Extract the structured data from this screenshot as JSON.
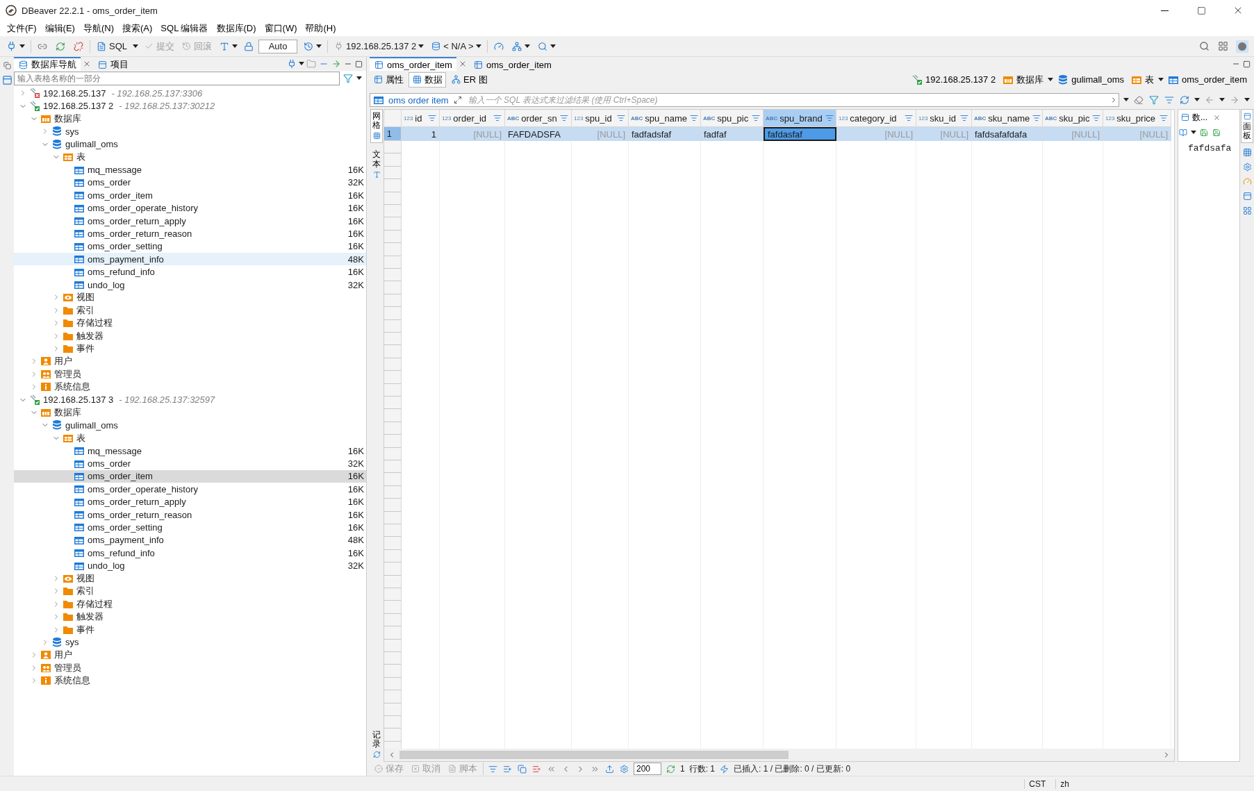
{
  "window": {
    "title": "DBeaver 22.2.1 - oms_order_item"
  },
  "menu": [
    "文件(F)",
    "编辑(E)",
    "导航(N)",
    "搜索(A)",
    "SQL 编辑器",
    "数据库(D)",
    "窗口(W)",
    "帮助(H)"
  ],
  "toolbar": {
    "sql": "SQL",
    "commit": {
      "label": "提交",
      "disabled": true
    },
    "rollback": {
      "label": "回滚",
      "disabled": true
    },
    "mode": "Auto",
    "connection": "192.168.25.137 2",
    "schema": "< N/A >"
  },
  "navigator": {
    "tabs": [
      {
        "label": "数据库导航",
        "selected": true,
        "closable": true
      },
      {
        "label": "项目",
        "selected": false,
        "closable": false
      }
    ],
    "filter": {
      "placeholder": "输入表格名称的一部分"
    },
    "tree": [
      {
        "kind": "connection",
        "label": "192.168.25.137",
        "detail": "- 192.168.25.137:3306",
        "connected": false,
        "expanded": false
      },
      {
        "kind": "connection",
        "label": "192.168.25.137 2",
        "detail": "- 192.168.25.137:30212",
        "connected": true,
        "expanded": true,
        "children": [
          {
            "kind": "databases",
            "label": "数据库",
            "expanded": true,
            "children": [
              {
                "kind": "database",
                "label": "sys",
                "expanded": false
              },
              {
                "kind": "database",
                "label": "gulimall_oms",
                "expanded": true,
                "children": [
                  {
                    "kind": "tables",
                    "label": "表",
                    "expanded": true,
                    "children": [
                      {
                        "kind": "table",
                        "label": "mq_message",
                        "size": "16K",
                        "selected": false,
                        "hovered": false
                      },
                      {
                        "kind": "table",
                        "label": "oms_order",
                        "size": "32K",
                        "selected": false,
                        "hovered": false
                      },
                      {
                        "kind": "table",
                        "label": "oms_order_item",
                        "size": "16K",
                        "selected": false,
                        "hovered": false
                      },
                      {
                        "kind": "table",
                        "label": "oms_order_operate_history",
                        "size": "16K",
                        "selected": false,
                        "hovered": false
                      },
                      {
                        "kind": "table",
                        "label": "oms_order_return_apply",
                        "size": "16K",
                        "selected": false,
                        "hovered": false
                      },
                      {
                        "kind": "table",
                        "label": "oms_order_return_reason",
                        "size": "16K",
                        "selected": false,
                        "hovered": false
                      },
                      {
                        "kind": "table",
                        "label": "oms_order_setting",
                        "size": "16K",
                        "selected": false,
                        "hovered": false
                      },
                      {
                        "kind": "table",
                        "label": "oms_payment_info",
                        "size": "48K",
                        "selected": false,
                        "hovered": true
                      },
                      {
                        "kind": "table",
                        "label": "oms_refund_info",
                        "size": "16K",
                        "selected": false,
                        "hovered": false
                      },
                      {
                        "kind": "table",
                        "label": "undo_log",
                        "size": "32K",
                        "selected": false,
                        "hovered": false
                      }
                    ]
                  },
                  {
                    "kind": "views",
                    "label": "视图",
                    "expanded": false
                  },
                  {
                    "kind": "folder",
                    "label": "索引",
                    "expanded": false
                  },
                  {
                    "kind": "folder",
                    "label": "存储过程",
                    "expanded": false
                  },
                  {
                    "kind": "folder",
                    "label": "触发器",
                    "expanded": false
                  },
                  {
                    "kind": "folder",
                    "label": "事件",
                    "expanded": false
                  }
                ]
              }
            ]
          },
          {
            "kind": "users",
            "label": "用户",
            "expanded": false
          },
          {
            "kind": "admins",
            "label": "管理员",
            "expanded": false
          },
          {
            "kind": "info",
            "label": "系统信息",
            "expanded": false
          }
        ]
      },
      {
        "kind": "connection",
        "label": "192.168.25.137 3",
        "detail": "- 192.168.25.137:32597",
        "connected": true,
        "expanded": true,
        "children": [
          {
            "kind": "databases",
            "label": "数据库",
            "expanded": true,
            "children": [
              {
                "kind": "database",
                "label": "gulimall_oms",
                "expanded": true,
                "children": [
                  {
                    "kind": "tables",
                    "label": "表",
                    "expanded": true,
                    "children": [
                      {
                        "kind": "table",
                        "label": "mq_message",
                        "size": "16K",
                        "selected": false,
                        "hovered": false
                      },
                      {
                        "kind": "table",
                        "label": "oms_order",
                        "size": "32K",
                        "selected": false,
                        "hovered": false
                      },
                      {
                        "kind": "table",
                        "label": "oms_order_item",
                        "size": "16K",
                        "selected": true,
                        "hovered": false
                      },
                      {
                        "kind": "table",
                        "label": "oms_order_operate_history",
                        "size": "16K",
                        "selected": false,
                        "hovered": false
                      },
                      {
                        "kind": "table",
                        "label": "oms_order_return_apply",
                        "size": "16K",
                        "selected": false,
                        "hovered": false
                      },
                      {
                        "kind": "table",
                        "label": "oms_order_return_reason",
                        "size": "16K",
                        "selected": false,
                        "hovered": false
                      },
                      {
                        "kind": "table",
                        "label": "oms_order_setting",
                        "size": "16K",
                        "selected": false,
                        "hovered": false
                      },
                      {
                        "kind": "table",
                        "label": "oms_payment_info",
                        "size": "48K",
                        "selected": false,
                        "hovered": false
                      },
                      {
                        "kind": "table",
                        "label": "oms_refund_info",
                        "size": "16K",
                        "selected": false,
                        "hovered": false
                      },
                      {
                        "kind": "table",
                        "label": "undo_log",
                        "size": "32K",
                        "selected": false,
                        "hovered": false
                      }
                    ]
                  },
                  {
                    "kind": "views",
                    "label": "视图",
                    "expanded": false
                  },
                  {
                    "kind": "folder",
                    "label": "索引",
                    "expanded": false
                  },
                  {
                    "kind": "folder",
                    "label": "存储过程",
                    "expanded": false
                  },
                  {
                    "kind": "folder",
                    "label": "触发器",
                    "expanded": false
                  },
                  {
                    "kind": "folder",
                    "label": "事件",
                    "expanded": false
                  }
                ]
              },
              {
                "kind": "database",
                "label": "sys",
                "expanded": false
              }
            ]
          },
          {
            "kind": "users",
            "label": "用户",
            "expanded": false
          },
          {
            "kind": "admins",
            "label": "管理员",
            "expanded": false
          },
          {
            "kind": "info",
            "label": "系统信息",
            "expanded": false
          }
        ]
      }
    ]
  },
  "editor": {
    "tabs": [
      {
        "label": "oms_order_item",
        "selected": true,
        "closable": true
      },
      {
        "label": "oms_order_item",
        "selected": false,
        "closable": false
      }
    ],
    "subtabs": [
      {
        "label": "属性",
        "selected": false
      },
      {
        "label": "数据",
        "selected": true
      },
      {
        "label": "ER 图",
        "selected": false
      }
    ],
    "breadcrumb": [
      {
        "kind": "connection",
        "label": "192.168.25.137 2"
      },
      {
        "kind": "databases",
        "label": "数据库"
      },
      {
        "kind": "database",
        "label": "gulimall_oms"
      },
      {
        "kind": "tables",
        "label": "表"
      },
      {
        "kind": "table",
        "label": "oms_order_item"
      }
    ],
    "filter": {
      "table": "oms order item",
      "placeholder": "输入一个 SQL 表达式来过滤结果 (使用 Ctrl+Space)"
    },
    "side_tabs": [
      {
        "label": "网格",
        "selected": true
      },
      {
        "label": "文本",
        "selected": false
      }
    ],
    "bottom_side_tab": "记录",
    "table": {
      "columns": [
        {
          "name": "id",
          "type_label": "123",
          "kind": "number",
          "selected": false
        },
        {
          "name": "order_id",
          "type_label": "123",
          "kind": "number",
          "selected": false
        },
        {
          "name": "order_sn",
          "type_label": "ABC",
          "kind": "text",
          "selected": false
        },
        {
          "name": "spu_id",
          "type_label": "123",
          "kind": "number",
          "selected": false
        },
        {
          "name": "spu_name",
          "type_label": "ABC",
          "kind": "text",
          "selected": false
        },
        {
          "name": "spu_pic",
          "type_label": "ABC",
          "kind": "text",
          "selected": false
        },
        {
          "name": "spu_brand",
          "type_label": "ABC",
          "kind": "text",
          "selected": true
        },
        {
          "name": "category_id",
          "type_label": "123",
          "kind": "number",
          "selected": false
        },
        {
          "name": "sku_id",
          "type_label": "123",
          "kind": "number",
          "selected": false
        },
        {
          "name": "sku_name",
          "type_label": "ABC",
          "kind": "text",
          "selected": false
        },
        {
          "name": "sku_pic",
          "type_label": "ABC",
          "kind": "text",
          "selected": false
        },
        {
          "name": "sku_price",
          "type_label": "123",
          "kind": "number",
          "selected": false
        }
      ],
      "rows": [
        {
          "number": "1",
          "selected": true,
          "cells": [
            {
              "value": "1",
              "null": false,
              "focused": false
            },
            {
              "value": "[NULL]",
              "null": true,
              "focused": false
            },
            {
              "value": "FAFDADSFA",
              "null": false,
              "focused": false
            },
            {
              "value": "[NULL]",
              "null": true,
              "focused": false
            },
            {
              "value": "fadfadsfaf",
              "null": false,
              "focused": false
            },
            {
              "value": "fadfaf",
              "null": false,
              "focused": false
            },
            {
              "value": "fafdasfaf",
              "null": false,
              "focused": true
            },
            {
              "value": "[NULL]",
              "null": true,
              "focused": false
            },
            {
              "value": "[NULL]",
              "null": true,
              "focused": false
            },
            {
              "value": "fafdsafafdafa",
              "null": false,
              "focused": false
            },
            {
              "value": "[NULL]",
              "null": true,
              "focused": false
            },
            {
              "value": "[NULL]",
              "null": true,
              "focused": false
            }
          ]
        }
      ]
    },
    "value_panel": {
      "tab": "数...",
      "value": "fafdsafa"
    },
    "right_side_tab": "面板",
    "bottom_toolbar": {
      "save": {
        "label": "保存",
        "disabled": true
      },
      "cancel": {
        "label": "取消",
        "disabled": true
      },
      "script": {
        "label": "脚本",
        "disabled": true
      },
      "fetch_size": "200",
      "refresh_count": "1",
      "row_count": "行数: 1",
      "changes": "已插入: 1 / 已删除: 0 / 已更新: 0"
    }
  },
  "status_bar": {
    "timezone": "CST",
    "locale": "zh"
  }
}
